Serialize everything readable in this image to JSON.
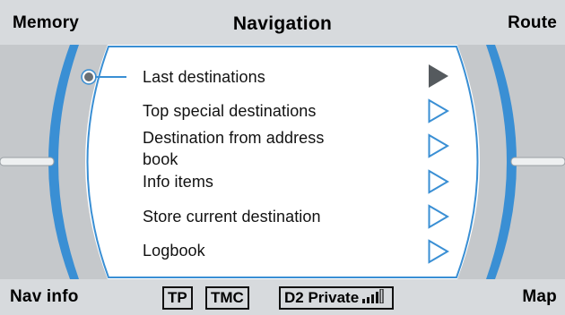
{
  "header": {
    "left_label": "Memory",
    "title": "Navigation",
    "right_label": "Route"
  },
  "menu": {
    "items": [
      {
        "label": "Last destinations",
        "selected": true
      },
      {
        "label": "Top special destinations",
        "selected": false
      },
      {
        "label": "Destination from address book",
        "label_line1": "Destination from address",
        "label_line2": "book",
        "selected": false
      },
      {
        "label": "Info items",
        "selected": false
      },
      {
        "label": "Store current destination",
        "selected": false
      },
      {
        "label": "Logbook",
        "selected": false
      }
    ]
  },
  "footer": {
    "left_label": "Nav info",
    "right_label": "Map",
    "status": {
      "tp": "TP",
      "tmc": "TMC",
      "network": "D2 Private"
    }
  },
  "colors": {
    "accent_blue": "#3a8fd4",
    "bar_gray": "#d7dadd",
    "panel_gray": "#c5c8cb"
  }
}
